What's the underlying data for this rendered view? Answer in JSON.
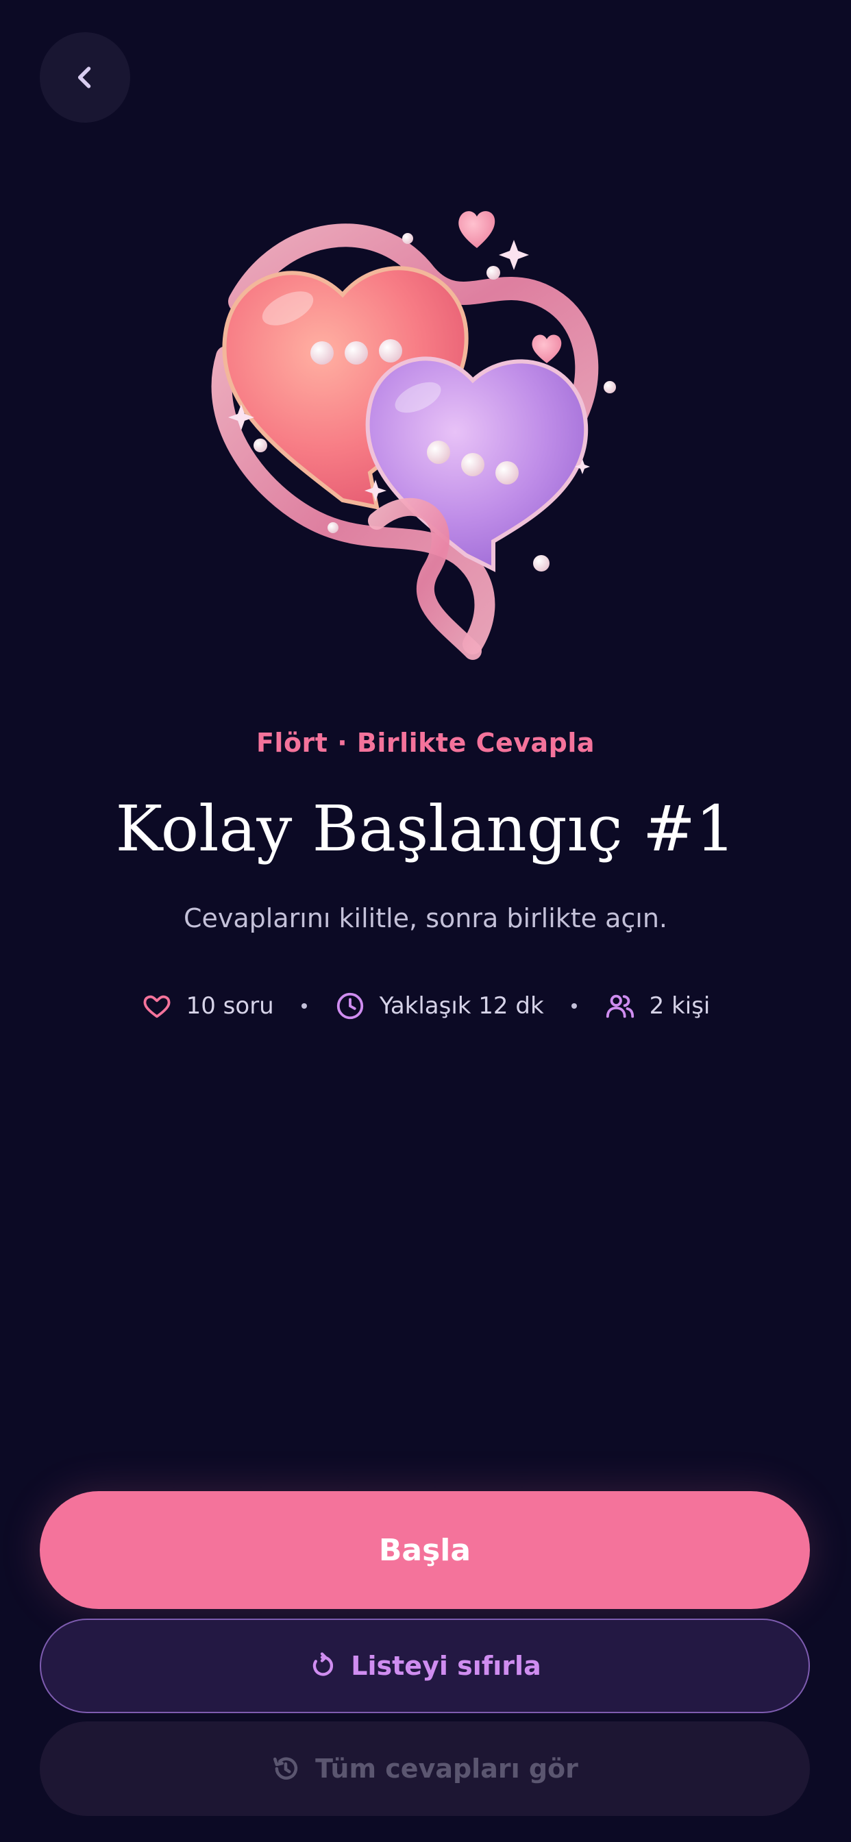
{
  "header": {
    "back_icon": "chevron-left-icon"
  },
  "hero": {
    "illustration": "two-heart-chat-bubbles-with-ribbon"
  },
  "quiz": {
    "category": "Flört · Birlikte Cevapla",
    "title": "Kolay Başlangıç #1",
    "subtitle": "Cevaplarını kilitle, sonra birlikte açın.",
    "meta": {
      "questions": "10 soru",
      "duration": "Yaklaşık 12 dk",
      "people": "2 kişi"
    }
  },
  "actions": {
    "start_label": "Başla",
    "reset_label": "Listeyi sıfırla",
    "all_answers_label": "Tüm cevapları gör"
  },
  "colors": {
    "background": "#0c0a25",
    "accent_pink": "#f4739b",
    "accent_purple": "#cf8df0",
    "muted": "#5b5670"
  }
}
